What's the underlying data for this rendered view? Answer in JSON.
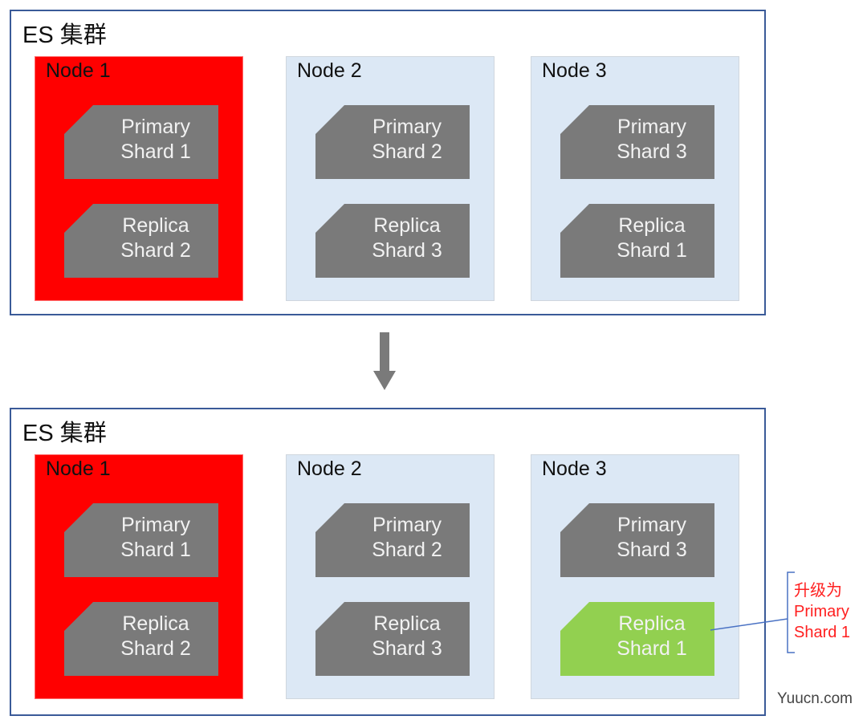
{
  "colors": {
    "cluster_border": "#3a5a98",
    "failed_node": "#ff0000",
    "normal_node": "#dce8f5",
    "shard": "#7a7a7a",
    "promoted_shard": "#92d050",
    "annotation": "#ff2020",
    "connector": "#4a72c4"
  },
  "before": {
    "title": "ES 集群",
    "nodes": [
      {
        "label": "Node 1",
        "state": "failed",
        "shards": [
          {
            "line1": "Primary",
            "line2": "Shard 1"
          },
          {
            "line1": "Replica",
            "line2": "Shard 2"
          }
        ]
      },
      {
        "label": "Node 2",
        "state": "normal",
        "shards": [
          {
            "line1": "Primary",
            "line2": "Shard 2"
          },
          {
            "line1": "Replica",
            "line2": "Shard 3"
          }
        ]
      },
      {
        "label": "Node 3",
        "state": "normal",
        "shards": [
          {
            "line1": "Primary",
            "line2": "Shard 3"
          },
          {
            "line1": "Replica",
            "line2": "Shard 1"
          }
        ]
      }
    ]
  },
  "after": {
    "title": "ES 集群",
    "nodes": [
      {
        "label": "Node 1",
        "state": "failed",
        "shards": [
          {
            "line1": "Primary",
            "line2": "Shard 1"
          },
          {
            "line1": "Replica",
            "line2": "Shard 2"
          }
        ]
      },
      {
        "label": "Node 2",
        "state": "normal",
        "shards": [
          {
            "line1": "Primary",
            "line2": "Shard 2"
          },
          {
            "line1": "Replica",
            "line2": "Shard 3"
          }
        ]
      },
      {
        "label": "Node 3",
        "state": "normal",
        "shards": [
          {
            "line1": "Primary",
            "line2": "Shard 3"
          },
          {
            "line1": "Replica",
            "line2": "Shard 1",
            "promoted": true
          }
        ]
      }
    ]
  },
  "arrow_icon": "down-arrow-icon",
  "annotation": {
    "line1": "升级为",
    "line2": "Primary",
    "line3": "Shard 1"
  },
  "watermark": "Yuucn.com"
}
